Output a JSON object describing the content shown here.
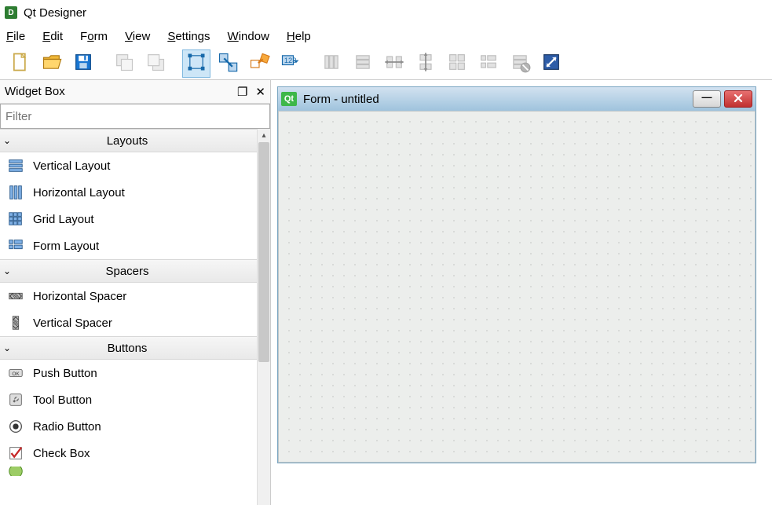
{
  "app": {
    "title": "Qt Designer"
  },
  "menubar": [
    "File",
    "Edit",
    "Form",
    "View",
    "Settings",
    "Window",
    "Help"
  ],
  "widgetbox": {
    "title": "Widget Box",
    "filter_placeholder": "Filter",
    "categories": [
      {
        "name": "Layouts",
        "items": [
          "Vertical Layout",
          "Horizontal Layout",
          "Grid Layout",
          "Form Layout"
        ]
      },
      {
        "name": "Spacers",
        "items": [
          "Horizontal Spacer",
          "Vertical Spacer"
        ]
      },
      {
        "name": "Buttons",
        "items": [
          "Push Button",
          "Tool Button",
          "Radio Button",
          "Check Box"
        ]
      }
    ]
  },
  "form_window": {
    "title": "Form - untitled"
  }
}
